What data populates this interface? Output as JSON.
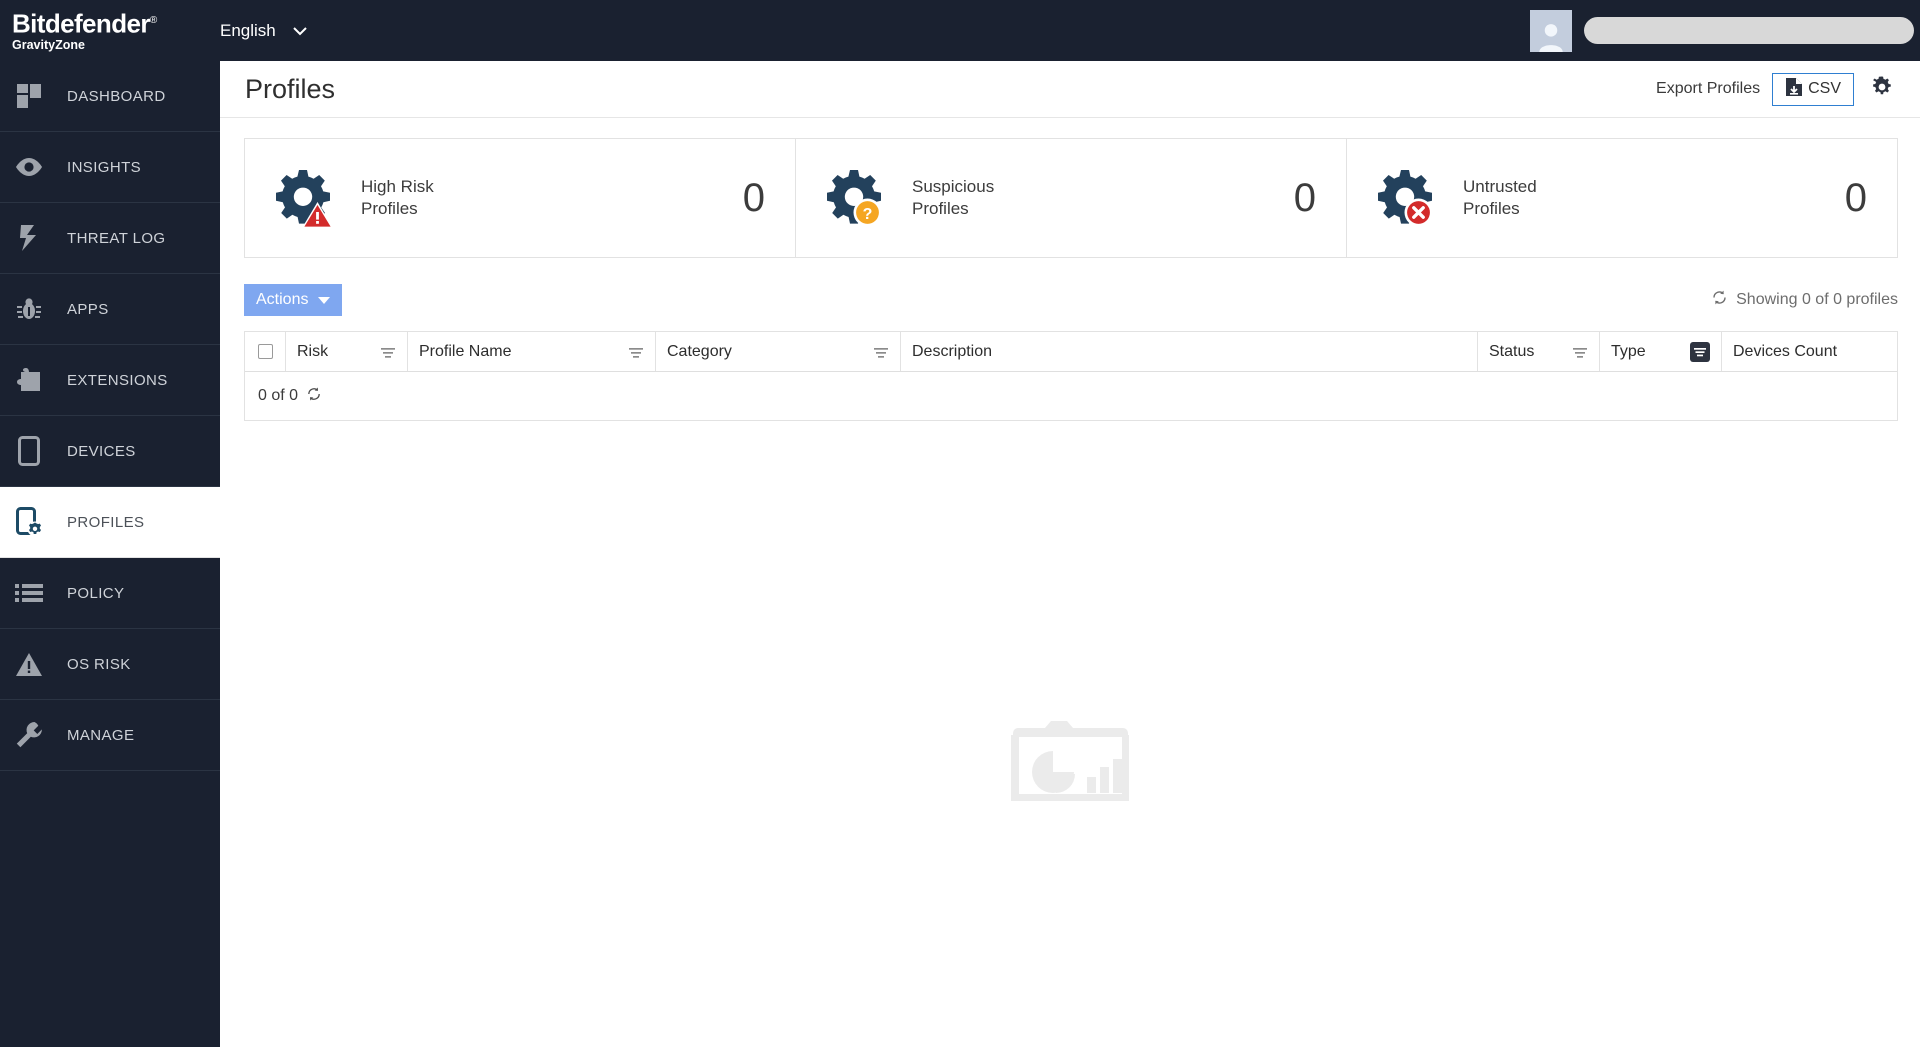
{
  "topbar": {
    "brand_name": "Bitdefender",
    "brand_reg": "®",
    "brand_sub": "GravityZone",
    "language": "English",
    "language_caret_icon": "chevron-down-icon",
    "avatar_icon": "user-avatar-icon"
  },
  "sidebar": {
    "items": [
      {
        "label": "DASHBOARD",
        "icon": "dashboard-grid-icon",
        "active": false
      },
      {
        "label": "INSIGHTS",
        "icon": "eye-icon",
        "active": false
      },
      {
        "label": "THREAT LOG",
        "icon": "lightning-bolt-icon",
        "active": false
      },
      {
        "label": "APPS",
        "icon": "bug-icon",
        "active": false
      },
      {
        "label": "EXTENSIONS",
        "icon": "puzzle-piece-icon",
        "active": false
      },
      {
        "label": "DEVICES",
        "icon": "mobile-device-icon",
        "active": false
      },
      {
        "label": "PROFILES",
        "icon": "device-gear-icon",
        "active": true
      },
      {
        "label": "POLICY",
        "icon": "list-icon",
        "active": false
      },
      {
        "label": "OS RISK",
        "icon": "warning-triangle-icon",
        "active": false
      },
      {
        "label": "MANAGE",
        "icon": "wrench-icon",
        "active": false
      }
    ]
  },
  "page": {
    "title": "Profiles",
    "export_label": "Export Profiles",
    "csv_label": "CSV",
    "csv_icon": "file-download-icon",
    "settings_icon": "gear-icon"
  },
  "cards": [
    {
      "line1": "High Risk",
      "line2": "Profiles",
      "count": "0",
      "icon": "gear-warning-icon",
      "badge": "warning-triangle-badge",
      "badge_color": "#d32b2b"
    },
    {
      "line1": "Suspicious",
      "line2": "Profiles",
      "count": "0",
      "icon": "gear-question-icon",
      "badge": "question-circle-badge",
      "badge_color": "#f5a623"
    },
    {
      "line1": "Untrusted",
      "line2": "Profiles",
      "count": "0",
      "icon": "gear-error-icon",
      "badge": "x-circle-badge",
      "badge_color": "#d32b2b"
    }
  ],
  "toolbar": {
    "actions_label": "Actions",
    "actions_caret_icon": "caret-down-icon",
    "showing_label": "Showing 0 of 0 profiles",
    "refresh_icon": "refresh-icon"
  },
  "table": {
    "select_all_checkbox": "unchecked",
    "columns": [
      {
        "label": "Risk",
        "filter": "filter-icon",
        "filter_active": false
      },
      {
        "label": "Profile Name",
        "filter": "filter-icon",
        "filter_active": false
      },
      {
        "label": "Category",
        "filter": "filter-icon",
        "filter_active": false
      },
      {
        "label": "Description",
        "filter": null,
        "filter_active": false
      },
      {
        "label": "Status",
        "filter": "filter-icon",
        "filter_active": false
      },
      {
        "label": "Type",
        "filter": "filter-icon",
        "filter_active": true
      },
      {
        "label": "Devices Count",
        "filter": null,
        "filter_active": false
      }
    ],
    "footer_count": "0 of 0",
    "footer_refresh_icon": "refresh-icon"
  },
  "empty_state": {
    "icon": "empty-folder-chart-icon"
  },
  "colors": {
    "sidebar_bg": "#1a2130",
    "accent_blue": "#7fa7f0",
    "csv_border": "#2f7fd1",
    "gear_dark": "#23415c",
    "warning_red": "#d32b2b",
    "warning_orange": "#f5a623"
  }
}
